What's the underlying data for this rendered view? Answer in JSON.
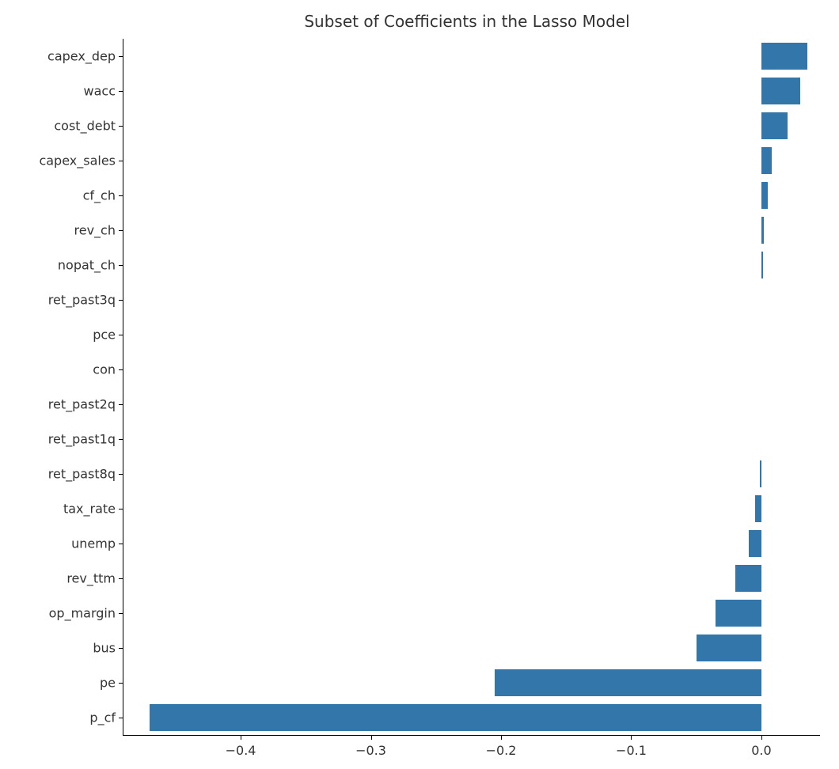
{
  "chart_data": {
    "type": "bar",
    "orientation": "horizontal",
    "title": "Subset of Coefficients in the Lasso Model",
    "xlabel": "",
    "ylabel": "",
    "xlim": [
      -0.49,
      0.045
    ],
    "x_ticks": [
      -0.4,
      -0.3,
      -0.2,
      -0.1,
      0.0
    ],
    "categories": [
      "capex_dep",
      "wacc",
      "cost_debt",
      "capex_sales",
      "cf_ch",
      "rev_ch",
      "nopat_ch",
      "ret_past3q",
      "pce",
      "con",
      "ret_past2q",
      "ret_past1q",
      "ret_past8q",
      "tax_rate",
      "unemp",
      "rev_ttm",
      "op_margin",
      "bus",
      "pe",
      "p_cf"
    ],
    "values": [
      0.035,
      0.03,
      0.02,
      0.008,
      0.005,
      0.002,
      0.001,
      0.0,
      0.0,
      0.0,
      0.0,
      0.0,
      -0.001,
      -0.005,
      -0.01,
      -0.02,
      -0.035,
      -0.05,
      -0.205,
      -0.47
    ],
    "bar_color": "#3376a9"
  }
}
